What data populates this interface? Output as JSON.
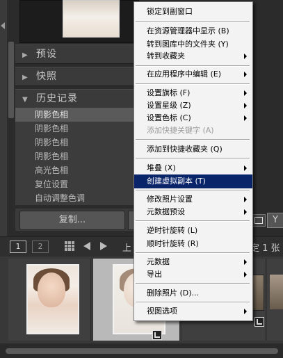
{
  "left_panel": {
    "panels": [
      {
        "label": "预设",
        "state": "collapsed"
      },
      {
        "label": "快照",
        "state": "collapsed"
      },
      {
        "label": "历史记录",
        "state": "expanded"
      }
    ],
    "history_items": [
      "阴影色相",
      "阴影色相",
      "阴影色相",
      "阴影色相",
      "高光色相",
      "复位设置",
      "自动调整色调"
    ],
    "copy_button": "复制..."
  },
  "right_edge": {
    "view_button_label": "Y"
  },
  "filmstrip_toolbar": {
    "view_1": "1",
    "view_2": "2",
    "left_text": "上",
    "right_text": "定 1 张"
  },
  "context_menu": {
    "items": [
      {
        "label": "锁定到副窗口",
        "submenu": false,
        "disabled": false,
        "highlight": false
      },
      {
        "label": "在资源管理器中显示 (B)",
        "submenu": false,
        "disabled": false,
        "highlight": false
      },
      {
        "label": "转到图库中的文件夹 (Y)",
        "submenu": false,
        "disabled": false,
        "highlight": false
      },
      {
        "label": "转到收藏夹",
        "submenu": true,
        "disabled": false,
        "highlight": false
      },
      {
        "label": "在应用程序中编辑 (E)",
        "submenu": true,
        "disabled": false,
        "highlight": false
      },
      {
        "label": "设置旗标 (F)",
        "submenu": true,
        "disabled": false,
        "highlight": false
      },
      {
        "label": "设置星级 (Z)",
        "submenu": true,
        "disabled": false,
        "highlight": false
      },
      {
        "label": "设置色标 (C)",
        "submenu": true,
        "disabled": false,
        "highlight": false
      },
      {
        "label": "添加快捷关键字 (A)",
        "submenu": false,
        "disabled": true,
        "highlight": false
      },
      {
        "label": "添加到快捷收藏夹 (Q)",
        "submenu": false,
        "disabled": false,
        "highlight": false
      },
      {
        "label": "堆叠 (X)",
        "submenu": true,
        "disabled": false,
        "highlight": false
      },
      {
        "label": "创建虚拟副本 (T)",
        "submenu": false,
        "disabled": false,
        "highlight": true
      },
      {
        "label": "修改照片设置",
        "submenu": true,
        "disabled": false,
        "highlight": false
      },
      {
        "label": "元数据预设",
        "submenu": true,
        "disabled": false,
        "highlight": false
      },
      {
        "label": "逆时针旋转 (L)",
        "submenu": false,
        "disabled": false,
        "highlight": false
      },
      {
        "label": "顺时针旋转 (R)",
        "submenu": false,
        "disabled": false,
        "highlight": false
      },
      {
        "label": "元数据",
        "submenu": true,
        "disabled": false,
        "highlight": false
      },
      {
        "label": "导出",
        "submenu": true,
        "disabled": false,
        "highlight": false
      },
      {
        "label": "删除照片 (D)...",
        "submenu": false,
        "disabled": false,
        "highlight": false
      },
      {
        "label": "视图选项",
        "submenu": true,
        "disabled": false,
        "highlight": false
      }
    ]
  }
}
